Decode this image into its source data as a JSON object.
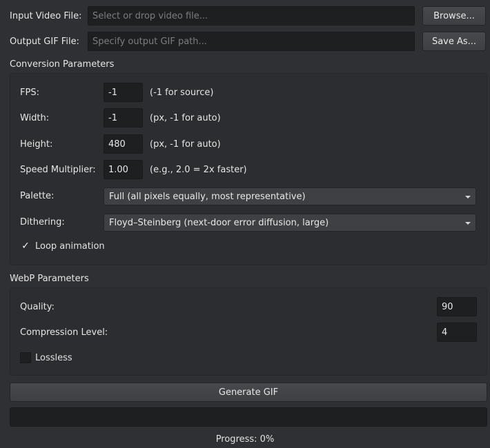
{
  "input": {
    "label": "Input Video File:",
    "placeholder": "Select or drop video file...",
    "value": "",
    "button": "Browse..."
  },
  "output": {
    "label": "Output GIF File:",
    "placeholder": "Specify output GIF path...",
    "value": "",
    "button": "Save As..."
  },
  "conversion": {
    "title": "Conversion Parameters",
    "fps": {
      "label": "FPS:",
      "value": "-1",
      "hint": "(-1 for source)"
    },
    "width": {
      "label": "Width:",
      "value": "-1",
      "hint": "(px, -1 for auto)"
    },
    "height": {
      "label": "Height:",
      "value": "480",
      "hint": "(px, -1 for auto)"
    },
    "speed": {
      "label": "Speed Multiplier:",
      "value": "1.00",
      "hint": "(e.g., 2.0 = 2x faster)"
    },
    "palette": {
      "label": "Palette:",
      "selected": "Full (all pixels equally, most representative)"
    },
    "dithering": {
      "label": "Dithering:",
      "selected": "Floyd–Steinberg (next-door error diffusion, large)"
    },
    "loop": {
      "label": "Loop animation",
      "checked": true,
      "mark": "✓"
    }
  },
  "webp": {
    "title": "WebP Parameters",
    "quality": {
      "label": "Quality:",
      "value": "90"
    },
    "compression": {
      "label": "Compression Level:",
      "value": "4"
    },
    "lossless": {
      "label": "Lossless",
      "checked": false
    }
  },
  "generate_label": "Generate GIF",
  "progress": {
    "text": "Progress: 0%",
    "percent": 0
  },
  "colors": {
    "background": "#2f3033",
    "field": "#1e1f21",
    "button": "#434548",
    "text": "#e2e2e2"
  }
}
